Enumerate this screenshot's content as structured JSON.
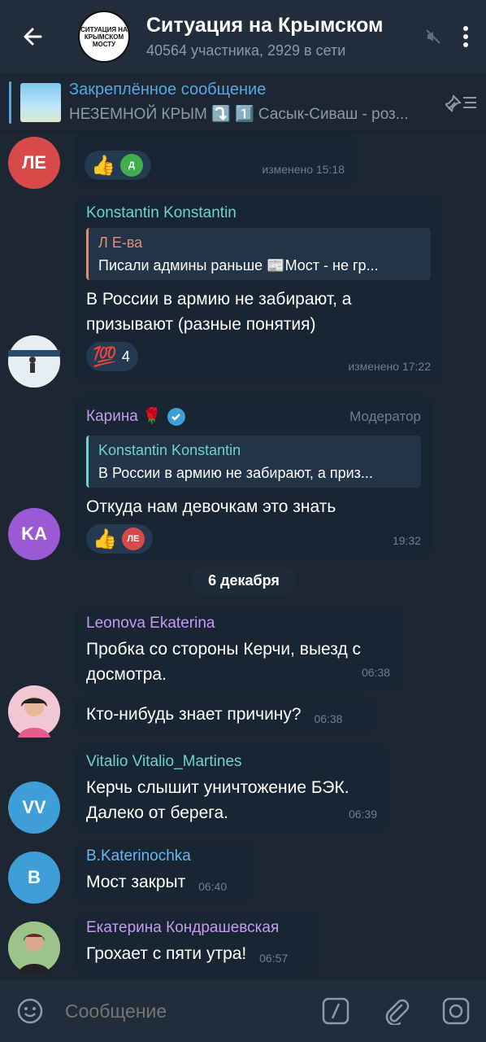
{
  "header": {
    "title": "Ситуация на Крымском",
    "subtitle": "40564 участника, 2929 в сети",
    "avatar_text": "СИТУАЦИЯ НА КРЫМСКОМ МОСТУ",
    "icons": [
      "back-arrow-icon",
      "muted-speaker-icon",
      "more-vert-icon"
    ]
  },
  "pinned": {
    "title": "Закреплённое сообщение",
    "text": "НЕЗЕМНОЙ КРЫМ ⤵️ 1️⃣ Сасык-Сиваш - роз..."
  },
  "messages": [
    {
      "id": "m1",
      "avatar": "ЛЕ",
      "avatar_color": "#d84a4a",
      "reaction_emoji": "👍",
      "reaction_avatar": "Д",
      "reaction_avatar_color": "#3fae4e",
      "time": "изменено 15:18"
    },
    {
      "id": "m2",
      "sender": "Konstantin Konstantin",
      "sender_color": "#6fd3c8",
      "reply_name": "Л Е-ва",
      "reply_color": "#e88b72",
      "reply_text": "Писали админы раньше 📰Мост - не гр...",
      "text": "В России в армию  не забирают, а призывают (разные понятия)",
      "reaction_emoji": "💯",
      "reaction_count": "4",
      "time": "изменено 17:22"
    },
    {
      "id": "m3",
      "sender": "Карина 🌹",
      "sender_color": "#c79af2",
      "role": "Модератор",
      "reply_name": "Konstantin Konstantin",
      "reply_color": "#6fd3c8",
      "reply_text": "В России в армию  не забирают, а приз...",
      "text": "Откуда нам девочкам это знать",
      "avatar": "KA",
      "avatar_color": "#9a5ad6",
      "reaction_emoji": "👍",
      "reaction_avatar": "ЛЕ",
      "reaction_avatar_color": "#d84a4a",
      "time": "19:32"
    },
    {
      "id": "m4",
      "sender": "Leonova Ekaterina",
      "sender_color": "#c79af2",
      "text": "Пробка со стороны Керчи, выезд с досмотра.",
      "time": "06:38"
    },
    {
      "id": "m5",
      "text": "Кто-нибудь знает причину?",
      "time": "06:38"
    },
    {
      "id": "m6",
      "sender": "Vitalio Vitalio_Martines",
      "sender_color": "#6fd3c8",
      "avatar": "VV",
      "avatar_color": "#3e9ed8",
      "text": "Керчь слышит уничтожение БЭК. Далеко от берега.",
      "time": "06:39"
    },
    {
      "id": "m7",
      "sender": "B.Katerinochka",
      "sender_color": "#6ab4f0",
      "avatar": "B",
      "avatar_color": "#3e9ed8",
      "text": "Мост закрыт",
      "time": "06:40"
    },
    {
      "id": "m8",
      "sender": "Екатерина Кондрашевская",
      "sender_color": "#c79af2",
      "text": "Грохает с пяти утра!",
      "time": "06:57"
    }
  ],
  "date_separator": "6 декабря",
  "input": {
    "placeholder": "Сообщение"
  }
}
